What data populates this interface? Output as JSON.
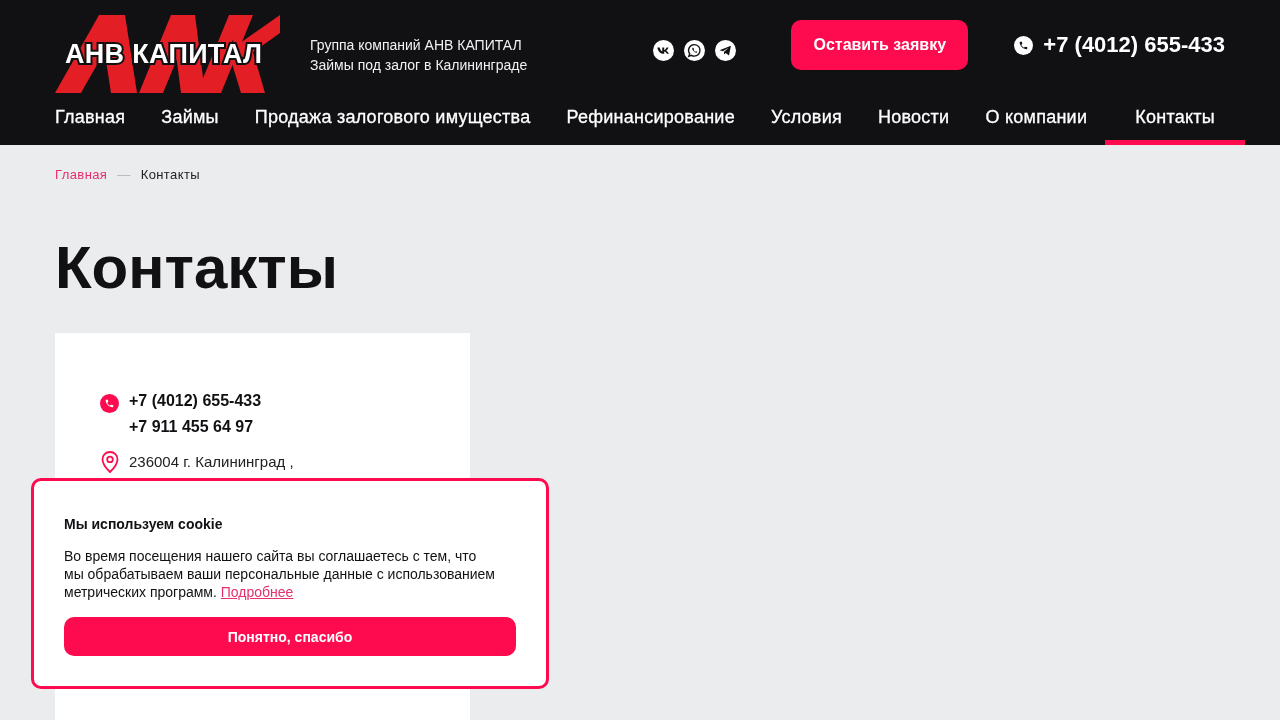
{
  "header": {
    "logo_text": "АНВ КАПИТАЛ",
    "tagline": [
      "Группа компаний АНВ КАПИТАЛ",
      "Займы под залог в Калининграде"
    ],
    "social_links": [
      {
        "kind": "vk"
      },
      {
        "kind": "whatsapp"
      },
      {
        "kind": "telegram"
      }
    ],
    "cta_button": "Оставить заявку",
    "phone": "+7 (4012) 655-433"
  },
  "nav": {
    "items": [
      {
        "label": "Главная",
        "selected": false
      },
      {
        "label": "Займы",
        "selected": false
      },
      {
        "label": "Продажа залогового имущества",
        "selected": false
      },
      {
        "label": "Рефинансирование",
        "selected": false
      },
      {
        "label": "Условия",
        "selected": false
      },
      {
        "label": "Новости",
        "selected": false
      },
      {
        "label": "О компании",
        "selected": false
      },
      {
        "label": "Контакты",
        "selected": true
      }
    ]
  },
  "breadcrumb": {
    "separator": "—",
    "items": [
      {
        "label": "Главная",
        "kind": "link"
      },
      {
        "label": "Контакты",
        "kind": "current"
      }
    ]
  },
  "page_title": "Контакты",
  "contact_card": {
    "phones": [
      "+7 (4012) 655-433",
      "+7 911 455 64 97"
    ],
    "address": "236004 г. Калининград ,"
  },
  "cookie_notice": {
    "title": "Мы используем cookie",
    "text": "Во время посещения нашего сайта вы соглашаетесь с тем, что мы обрабатываем ваши персональные данные с использованием метрических программ.",
    "link": "Подробнее",
    "button": "Понятно, спасибо"
  }
}
